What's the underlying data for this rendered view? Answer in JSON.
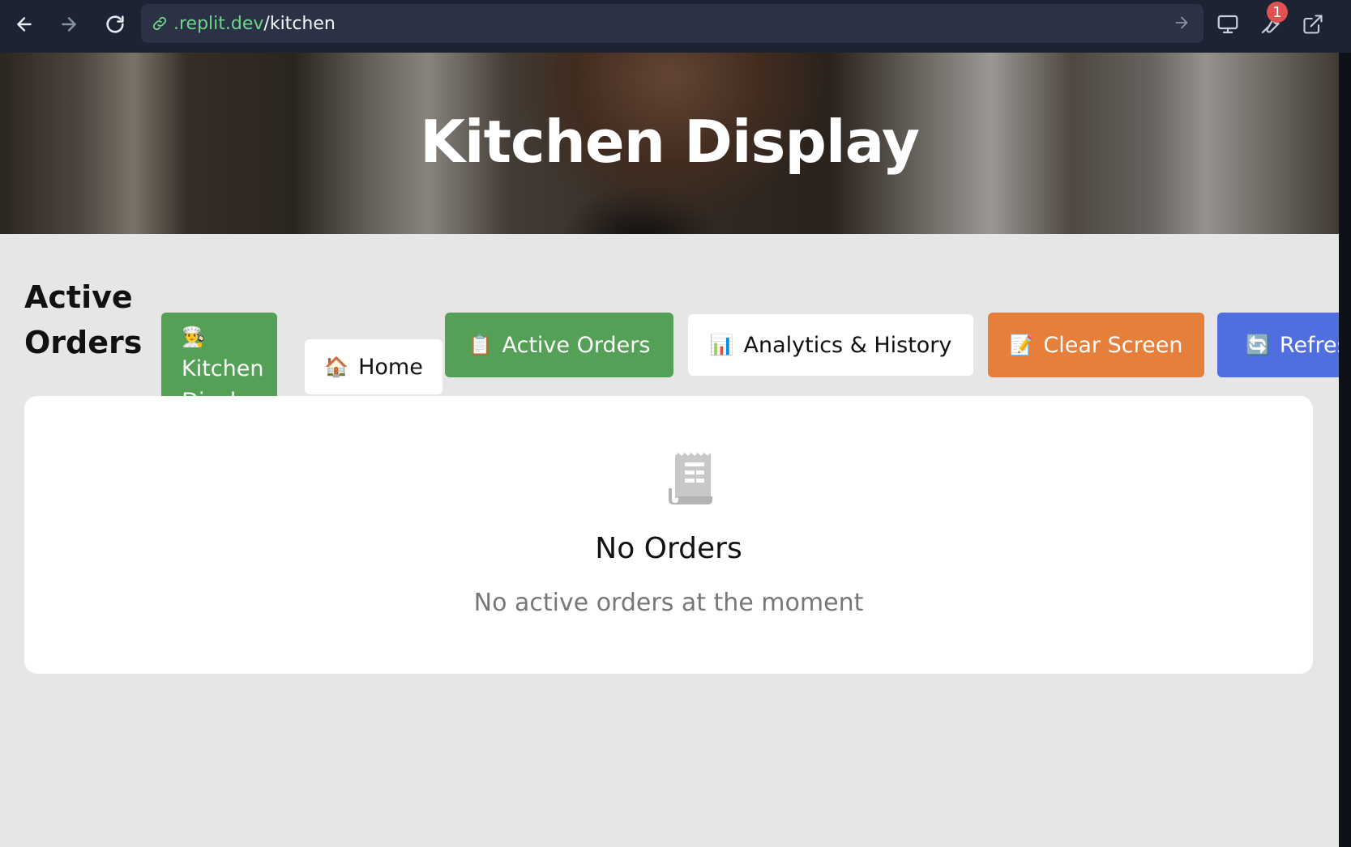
{
  "browser": {
    "url_domain": ".replit.dev",
    "url_path": "/kitchen",
    "notification_count": "1"
  },
  "hero": {
    "title": "Kitchen Display"
  },
  "toolbar": {
    "section_title": "Active Orders",
    "buttons": {
      "kitchen": {
        "icon": "👨‍🍳",
        "label": "Kitchen Display"
      },
      "home": {
        "icon": "🏠",
        "label": "Home"
      },
      "active": {
        "icon": "📋",
        "label": "Active Orders"
      },
      "analytics": {
        "icon": "📊",
        "label": "Analytics & History"
      },
      "clear": {
        "icon": "📝",
        "label": "Clear Screen"
      },
      "refresh": {
        "icon": "🔄",
        "label": "Refres"
      }
    }
  },
  "empty_state": {
    "icon": "receipt-icon",
    "title": "No Orders",
    "message": "No active orders at the moment"
  },
  "colors": {
    "green": "#55a057",
    "orange": "#e57f3a",
    "blue": "#4f6fe0",
    "page_bg": "#e6e6e6",
    "chrome_bg": "#1c2333"
  }
}
